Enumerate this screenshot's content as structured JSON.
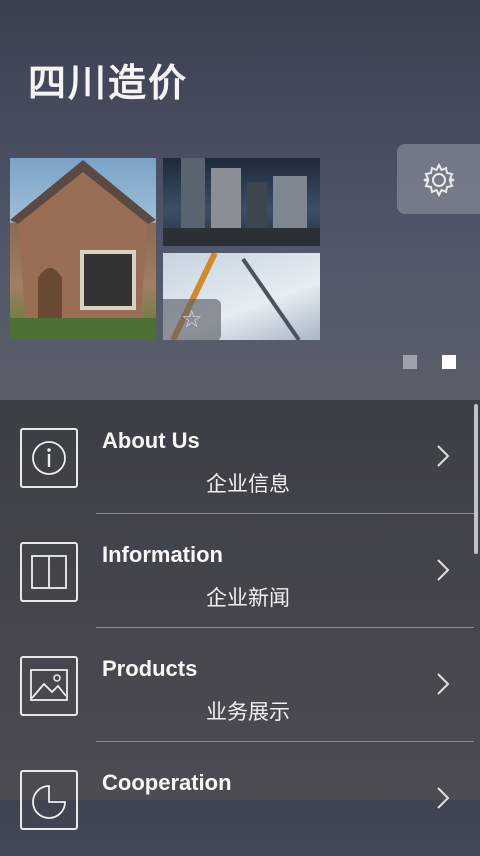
{
  "app": {
    "title": "四川造价"
  },
  "header": {
    "settings_icon": "gear-icon"
  },
  "banner": {
    "images": [
      "house-photo",
      "city-skyline-photo",
      "construction-crane-photo"
    ],
    "favorite_icon": "star-icon",
    "pagination": {
      "total": 2,
      "active": 2
    }
  },
  "menu": {
    "items": [
      {
        "label_en": "About Us",
        "label_cn": "企业信息",
        "icon": "info-icon"
      },
      {
        "label_en": "Information",
        "label_cn": "企业新闻",
        "icon": "book-icon"
      },
      {
        "label_en": "Products",
        "label_cn": "业务展示",
        "icon": "image-icon"
      },
      {
        "label_en": "Cooperation",
        "label_cn": "",
        "icon": "pie-chart-icon"
      }
    ]
  },
  "colors": {
    "background": "#4a4d53",
    "accent": "#ffffff"
  }
}
